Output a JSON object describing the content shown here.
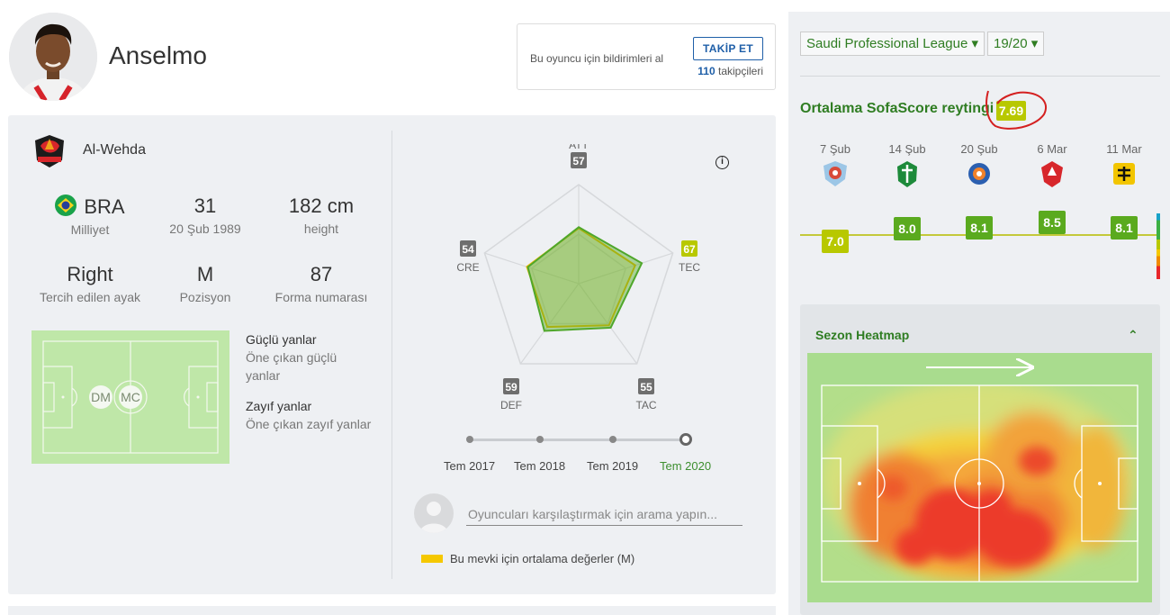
{
  "player": {
    "name": "Anselmo",
    "club": "Al-Wehda"
  },
  "follow": {
    "text": "Bu oyuncu için bildirimleri al",
    "button": "TAKİP ET",
    "count": "110",
    "count_label": "takipçileri"
  },
  "stats": {
    "nationality": {
      "value": "BRA",
      "label": "Milliyet"
    },
    "age": {
      "value": "31",
      "label": "20 Şub 1989"
    },
    "height": {
      "value": "182 cm",
      "label": "height"
    },
    "foot": {
      "value": "Right",
      "label": "Tercih edilen ayak"
    },
    "position": {
      "value": "M",
      "label": "Pozisyon"
    },
    "shirt": {
      "value": "87",
      "label": "Forma numarası"
    }
  },
  "positions": [
    "DM",
    "MC"
  ],
  "strengths": {
    "title": "Güçlü yanlar",
    "text": "Öne çıkan güçlü yanlar"
  },
  "weaknesses": {
    "title": "Zayıf yanlar",
    "text": "Öne çıkan zayıf yanlar"
  },
  "attributes": {
    "axes": [
      {
        "code": "ATT",
        "value": 57
      },
      {
        "code": "TEC",
        "value": 67
      },
      {
        "code": "TAC",
        "value": 55
      },
      {
        "code": "DEF",
        "value": 59
      },
      {
        "code": "CRE",
        "value": 54
      }
    ],
    "average": {
      "label": "Bu mevki için ortalama değerler (M)",
      "values": [
        56,
        60,
        52,
        54,
        55
      ]
    },
    "seasons": [
      "Tem 2017",
      "Tem 2018",
      "Tem 2019",
      "Tem 2020"
    ],
    "selected_season": "Tem 2020",
    "info_icon": "i"
  },
  "compare": {
    "placeholder": "Oyuncuları karşılaştırmak için arama yapın..."
  },
  "league": {
    "tournament": "Saudi Professional League ▾",
    "season": "19/20 ▾"
  },
  "rating": {
    "title": "Ortalama SofaScore reytingi",
    "average": "7.69",
    "matches": [
      {
        "date": "7 Şub",
        "rating": "7.0",
        "value": 7.0,
        "color": "#b8c800"
      },
      {
        "date": "14 Şub",
        "rating": "8.0",
        "value": 8.0,
        "color": "#5aaa1e"
      },
      {
        "date": "20 Şub",
        "rating": "8.1",
        "value": 8.1,
        "color": "#5aaa1e"
      },
      {
        "date": "6 Mar",
        "rating": "8.5",
        "value": 8.5,
        "color": "#5aaa1e"
      },
      {
        "date": "11 Mar",
        "rating": "8.1",
        "value": 8.1,
        "color": "#5aaa1e"
      }
    ]
  },
  "heatmap": {
    "title": "Sezon Heatmap",
    "toggle": "⌃"
  },
  "colors": {
    "accent_green": "#2f7d22",
    "follow_blue": "#1f5fa8",
    "highlight_red": "#d42020"
  }
}
